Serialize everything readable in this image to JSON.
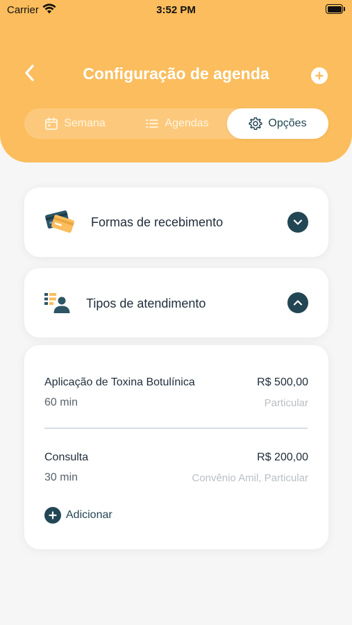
{
  "status_bar": {
    "carrier": "Carrier",
    "time": "3:52 PM"
  },
  "header": {
    "title": "Configuração de agenda",
    "back_icon": "chevron-left-icon",
    "add_icon": "plus-icon"
  },
  "tabs": [
    {
      "label": "Semana",
      "icon": "calendar-icon",
      "active": false
    },
    {
      "label": "Agendas",
      "icon": "list-icon",
      "active": false
    },
    {
      "label": "Opções",
      "icon": "gear-icon",
      "active": true
    }
  ],
  "sections": [
    {
      "title": "Formas de recebimento",
      "icon": "credit-cards-icon",
      "expanded": false
    },
    {
      "title": "Tipos de atendimento",
      "icon": "person-list-icon",
      "expanded": true
    }
  ],
  "services": [
    {
      "name": "Aplicação de Toxina Botulínica",
      "price": "R$ 500,00",
      "duration": "60 min",
      "plans": "Particular"
    },
    {
      "name": "Consulta",
      "price": "R$ 200,00",
      "duration": "30 min",
      "plans": "Convênio Amil, Particular"
    }
  ],
  "add_service": {
    "label": "Adicionar"
  },
  "colors": {
    "header": "#fbbd5d",
    "accent": "#234654",
    "background": "#f6f6f6"
  }
}
